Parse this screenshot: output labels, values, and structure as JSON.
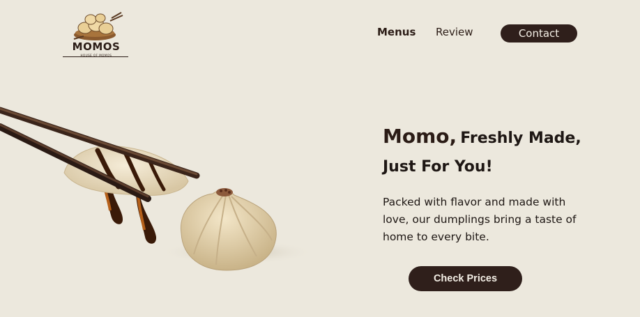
{
  "logo": {
    "name": "MOMOS",
    "tagline": "HOUSE OF MOMOS"
  },
  "nav": {
    "menus": "Menus",
    "review": "Review",
    "contact": "Contact"
  },
  "hero": {
    "title_brand": "Momo,",
    "title_rest": "Freshly Made, Just For You!",
    "description": "Packed with flavor and made with love, our dumplings bring a taste of home to every bite.",
    "cta": "Check Prices"
  },
  "colors": {
    "background": "#ece8dd",
    "accent": "#2f1f1b",
    "button_text": "#f4efe6"
  }
}
